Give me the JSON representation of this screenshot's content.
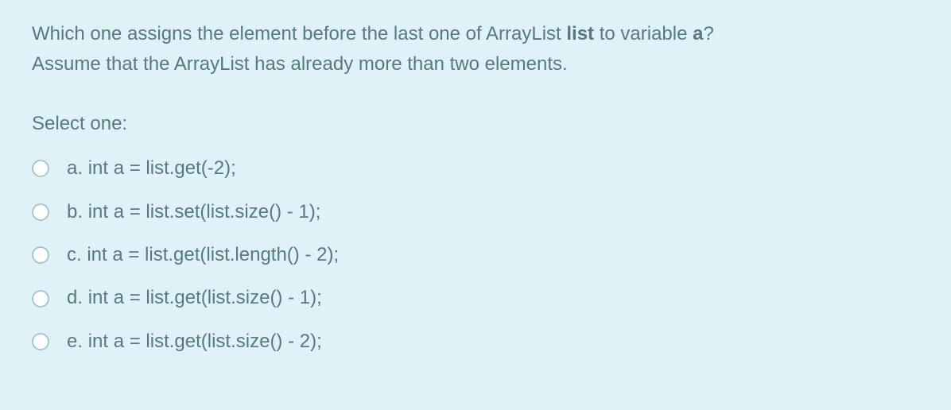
{
  "question": {
    "line1_pre": "Which one assigns the element before the last one of ArrayList ",
    "line1_bold1": "list",
    "line1_mid": " to variable ",
    "line1_bold2": "a",
    "line1_end": "?",
    "line2": "Assume that the ArrayList has already more than two elements."
  },
  "select_prompt": "Select one:",
  "options": [
    {
      "letter": "a.",
      "text": "int a = list.get(-2);"
    },
    {
      "letter": "b.",
      "text": "int a = list.set(list.size() - 1);"
    },
    {
      "letter": "c.",
      "text": "int a = list.get(list.length() - 2);"
    },
    {
      "letter": "d.",
      "text": "int a = list.get(list.size() - 1);"
    },
    {
      "letter": "e.",
      "text": "int a = list.get(list.size() - 2);"
    }
  ]
}
